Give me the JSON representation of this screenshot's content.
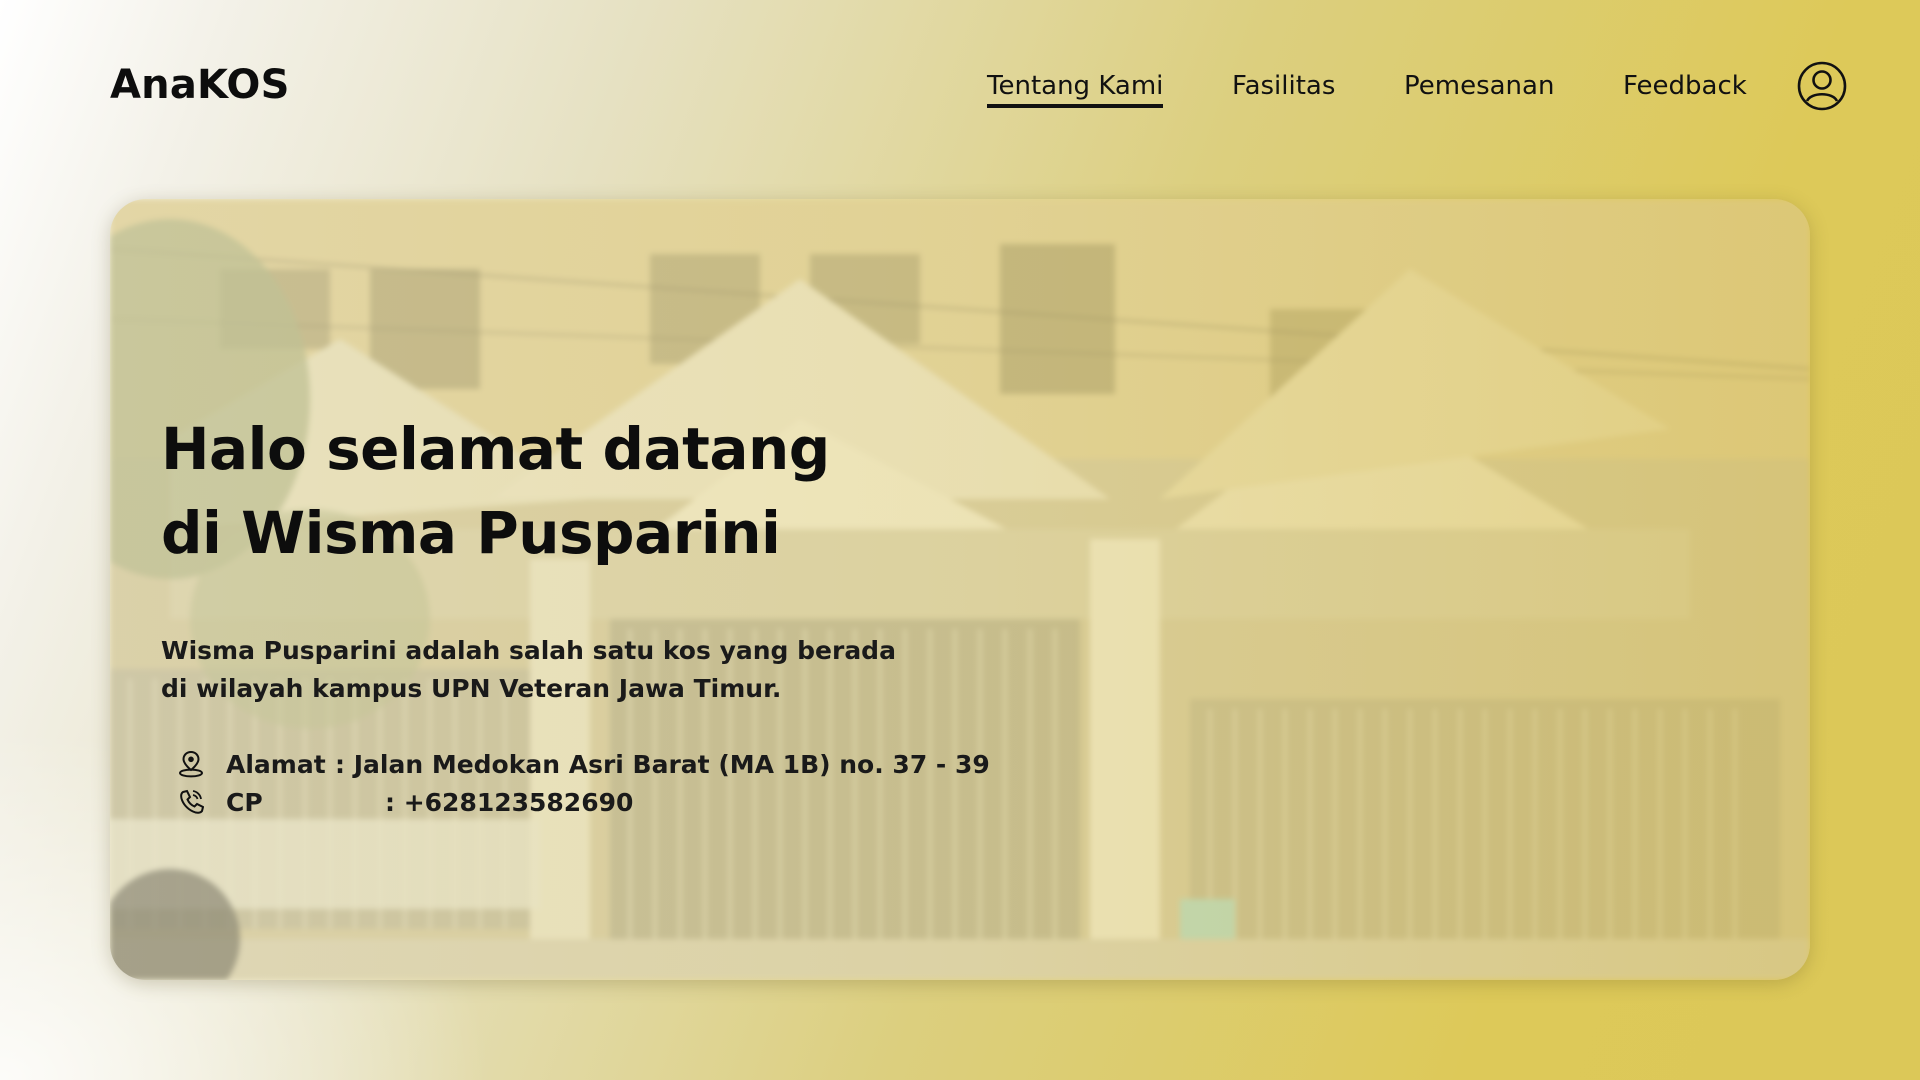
{
  "header": {
    "logo": "AnaKOS",
    "nav": [
      {
        "label": "Tentang Kami",
        "active": true
      },
      {
        "label": "Fasilitas",
        "active": false
      },
      {
        "label": "Pemesanan",
        "active": false
      },
      {
        "label": "Feedback",
        "active": false
      }
    ],
    "profile_icon": "user-circle-icon"
  },
  "hero": {
    "title_line1": "Halo selamat datang",
    "title_line2": "di Wisma Pusparini",
    "description": "Wisma Pusparini adalah salah satu kos yang berada di wilayah kampus UPN Veteran Jawa Timur.",
    "address": {
      "icon": "location-pin-icon",
      "label": "Alamat",
      "value": ": Jalan Medokan Asri Barat (MA 1B)  no. 37 - 39"
    },
    "contact": {
      "icon": "phone-icon",
      "label": "CP",
      "value": ": +628123582690"
    }
  },
  "colors": {
    "accent_yellow": "#dcc858",
    "text": "#0d0d0d"
  }
}
